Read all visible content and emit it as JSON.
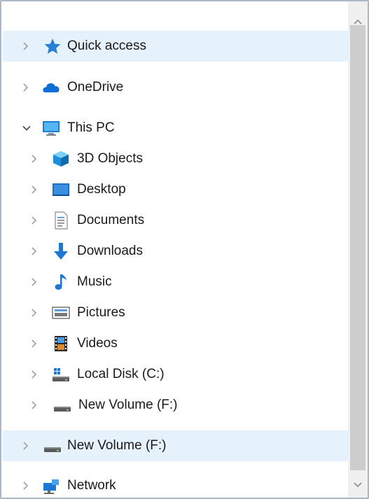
{
  "nav_tree": {
    "items": [
      {
        "label": "Quick access",
        "icon": "star-icon",
        "expanded": false,
        "highlighted": true
      },
      {
        "label": "OneDrive",
        "icon": "cloud-icon",
        "expanded": false,
        "highlighted": false
      },
      {
        "label": "This PC",
        "icon": "monitor-icon",
        "expanded": true,
        "highlighted": false
      },
      {
        "label": "3D Objects",
        "icon": "cube-3d-icon",
        "expanded": false,
        "highlighted": false
      },
      {
        "label": "Desktop",
        "icon": "desktop-icon",
        "expanded": false,
        "highlighted": false
      },
      {
        "label": "Documents",
        "icon": "document-icon",
        "expanded": false,
        "highlighted": false
      },
      {
        "label": "Downloads",
        "icon": "download-arrow-icon",
        "expanded": false,
        "highlighted": false
      },
      {
        "label": "Music",
        "icon": "music-note-icon",
        "expanded": false,
        "highlighted": false
      },
      {
        "label": "Pictures",
        "icon": "picture-icon",
        "expanded": false,
        "highlighted": false
      },
      {
        "label": "Videos",
        "icon": "film-icon",
        "expanded": false,
        "highlighted": false
      },
      {
        "label": "Local Disk (C:)",
        "icon": "system-drive-icon",
        "expanded": false,
        "highlighted": false
      },
      {
        "label": "New Volume (F:)",
        "icon": "drive-icon",
        "expanded": false,
        "highlighted": false
      },
      {
        "label": "New Volume (F:)",
        "icon": "drive-icon",
        "expanded": false,
        "highlighted": true
      },
      {
        "label": "Network",
        "icon": "network-icon",
        "expanded": false,
        "highlighted": false
      }
    ]
  },
  "colors": {
    "highlight": "#e5f1fb",
    "border": "#a9b7c6",
    "scroll_track": "#f0f0f0",
    "scroll_thumb": "#cdcdcd"
  }
}
